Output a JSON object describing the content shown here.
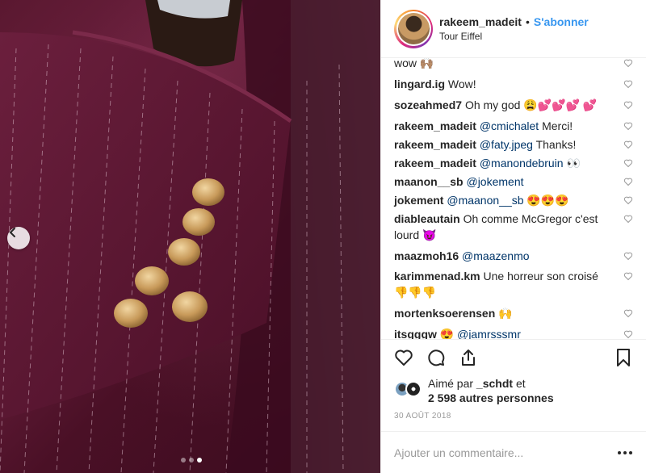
{
  "header": {
    "username": "rakeem_madeit",
    "separator": "•",
    "follow_label": "S'abonner",
    "location": "Tour Eiffel"
  },
  "photo": {
    "dots_count": 3,
    "active_dot": 2
  },
  "comments": [
    {
      "user": "",
      "text": "wow 🙌🏽",
      "mention": ""
    },
    {
      "user": "lingard.ig",
      "text": "Wow!",
      "mention": ""
    },
    {
      "user": "sozeahmed7",
      "text": "Oh my god 😩💕💕💕 💕",
      "mention": ""
    },
    {
      "user": "rakeem_madeit",
      "mention": "@cmichalet",
      "text": "Merci!"
    },
    {
      "user": "rakeem_madeit",
      "mention": "@faty.jpeg",
      "text": "Thanks!"
    },
    {
      "user": "rakeem_madeit",
      "mention": "@manondebruin",
      "text": "👀"
    },
    {
      "user": "maanon__sb",
      "mention": "@jokement",
      "text": ""
    },
    {
      "user": "jokement",
      "mention": "@maanon__sb",
      "text": "😍😍😍"
    },
    {
      "user": "diableautain",
      "mention": "",
      "text": "Oh comme McGregor c'est lourd 😈"
    },
    {
      "user": "maazmoh16",
      "mention": "@maazenmo",
      "text": ""
    },
    {
      "user": "karimmenad.km",
      "mention": "",
      "text": "Une horreur son croisé 👎👎👎"
    },
    {
      "user": "mortenksoerensen",
      "mention": "",
      "text": "🙌"
    },
    {
      "user": "itsgggw",
      "mention": "@jamrsssmr",
      "text": "😍"
    }
  ],
  "likes": {
    "line1_prefix": "Aimé par",
    "line1_user": "_schdt",
    "line1_suffix": "et",
    "line2": "2 598 autres personnes"
  },
  "date": "30 AOÛT 2018",
  "add_comment": {
    "placeholder": "Ajouter un commentaire..."
  },
  "icons": {
    "like": "heart-icon",
    "comment": "comment-icon",
    "share": "share-icon",
    "save": "bookmark-icon",
    "more": "more-dots-icon",
    "prev": "chevron-left-icon"
  },
  "colors": {
    "follow": "#3897f0",
    "mention": "#003569",
    "text": "#262626",
    "muted": "#999999"
  }
}
